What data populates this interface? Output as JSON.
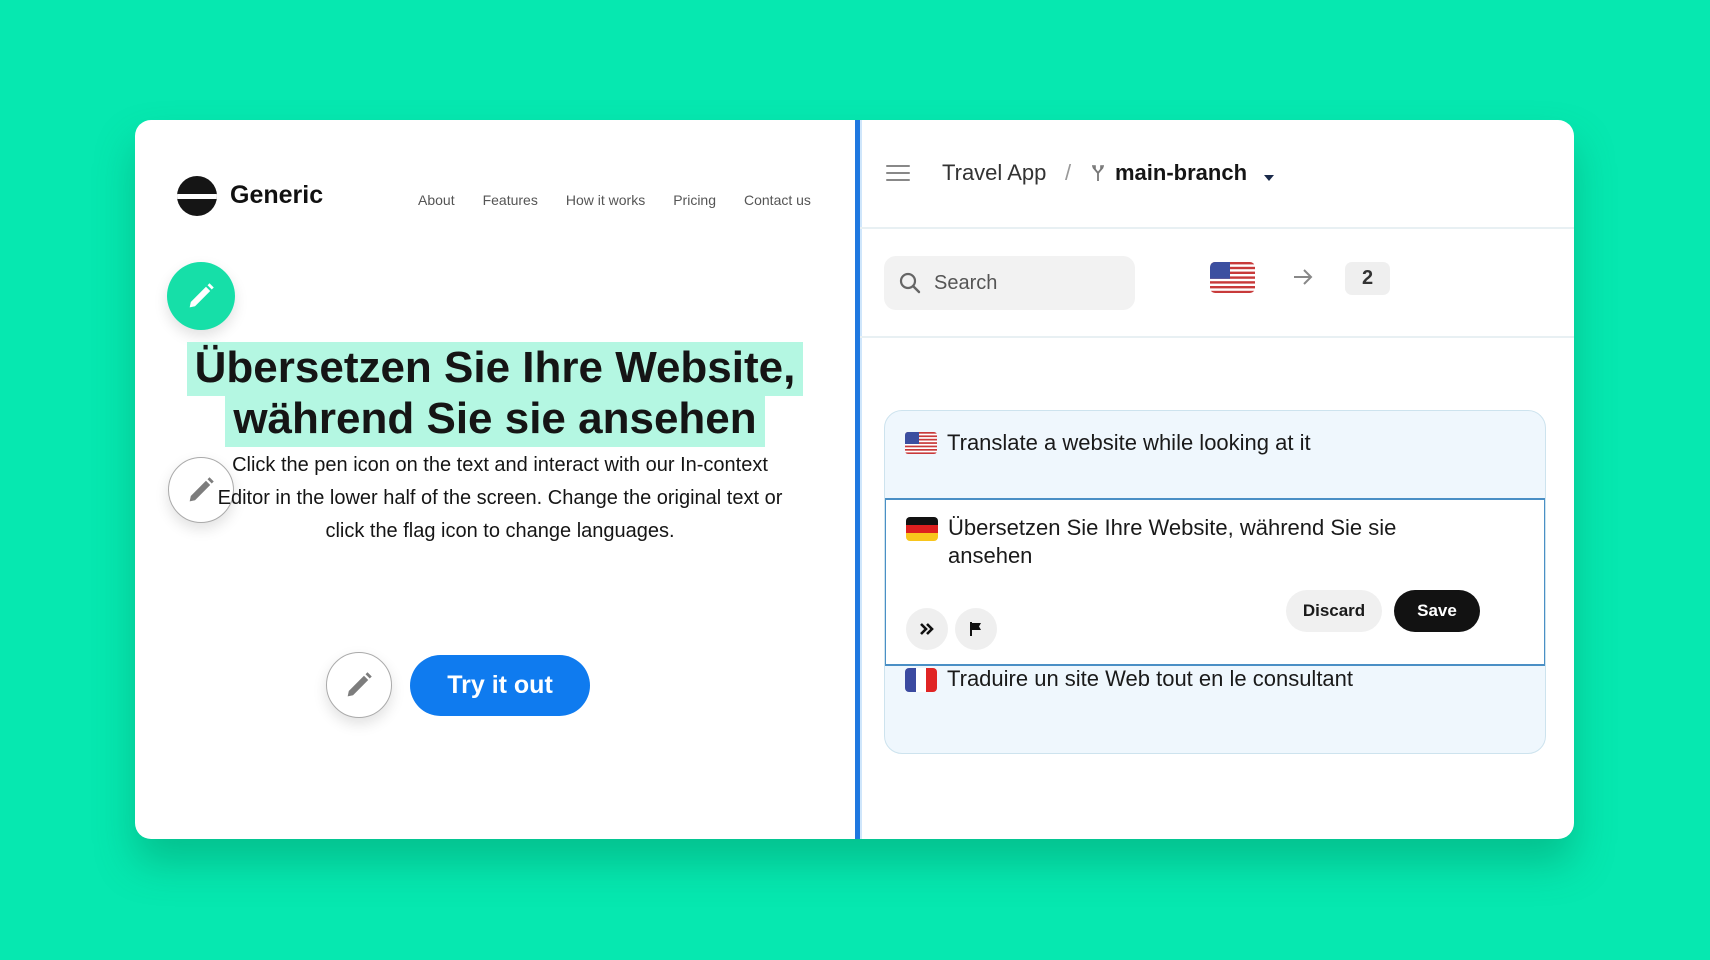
{
  "website": {
    "brand": "Generic",
    "nav": [
      "About",
      "Features",
      "How it works",
      "Pricing",
      "Contact us"
    ],
    "headline_line1": "Übersetzen Sie Ihre Website,",
    "headline_line2": "während Sie sie ansehen",
    "paragraph": "Click the pen icon on the text and interact with our In-context Editor in the lower half of the screen. Change the original text or click the flag icon to change languages.",
    "cta_label": "Try it out",
    "icons": {
      "edit": "pencil-icon",
      "logo": "logo-icon"
    }
  },
  "editor": {
    "breadcrumb": {
      "project": "Travel App",
      "separator": "/",
      "branch": "main-branch"
    },
    "search": {
      "placeholder": "Search",
      "value": ""
    },
    "source_language": "en-US",
    "target_count": "2",
    "translations": [
      {
        "language": "en",
        "flag": "us-flag",
        "text": "Translate a website while looking at it"
      },
      {
        "language": "de",
        "flag": "german-flag",
        "text": "Übersetzen Sie Ihre Website, während Sie sie ansehen",
        "editing": true
      },
      {
        "language": "fr",
        "flag": "french-flag",
        "text": "Traduire un site Web tout en le consultant"
      }
    ],
    "actions": {
      "discard": "Discard",
      "save": "Save"
    },
    "icons": {
      "menu": "hamburger-icon",
      "branch": "branch-icon",
      "arrow": "arrow-right-icon",
      "auto_translate": "double-chevron-icon",
      "flag": "flag-icon"
    }
  },
  "colors": {
    "background": "#06e8b0",
    "accent_green": "#16dfa8",
    "highlight": "#b4f7e2",
    "cta_blue": "#0f7bef",
    "divider_blue": "#1f78e0",
    "active_border": "#4a8fc5"
  }
}
